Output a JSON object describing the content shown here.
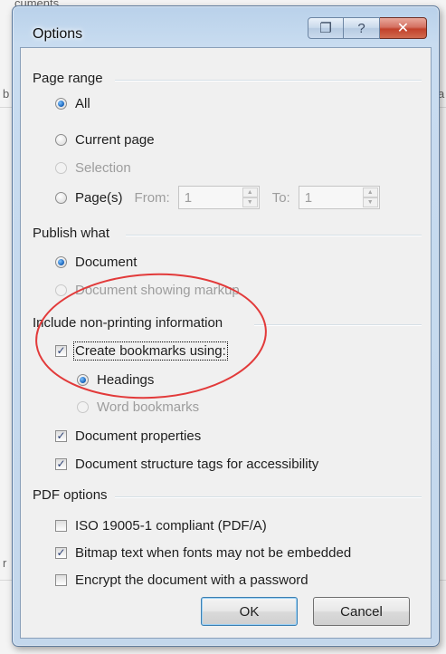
{
  "background": {
    "peek_text": "cuments",
    "peek_left": "b",
    "peek_right": "a",
    "peek_left2": "r"
  },
  "dialog": {
    "title": "Options",
    "titlebar_buttons": [
      {
        "name": "restore-icon",
        "glyph": "❐"
      },
      {
        "name": "help-icon",
        "glyph": "?"
      },
      {
        "name": "close-icon",
        "glyph": "✕"
      }
    ]
  },
  "page_range": {
    "label": "Page range",
    "options": [
      {
        "label": "All",
        "checked": true,
        "disabled": false
      },
      {
        "label": "Current page",
        "checked": false,
        "disabled": false
      },
      {
        "label": "Selection",
        "checked": false,
        "disabled": true
      },
      {
        "label": "Page(s)",
        "checked": false,
        "disabled": false
      }
    ],
    "from_label": "From:",
    "from_value": "1",
    "to_label": "To:",
    "to_value": "1"
  },
  "publish_what": {
    "label": "Publish what",
    "options": [
      {
        "label": "Document",
        "checked": true,
        "disabled": false
      },
      {
        "label": "Document showing markup",
        "checked": false,
        "disabled": true
      }
    ]
  },
  "non_printing": {
    "label": "Include non-printing information",
    "create_bookmarks": {
      "label": "Create bookmarks using:",
      "checked": true
    },
    "bookmark_options": [
      {
        "label": "Headings",
        "checked": true,
        "disabled": false
      },
      {
        "label": "Word bookmarks",
        "checked": false,
        "disabled": true
      }
    ],
    "document_properties": {
      "label": "Document properties",
      "checked": true
    },
    "structure_tags": {
      "label": "Document structure tags for accessibility",
      "checked": true
    }
  },
  "pdf_options": {
    "label": "PDF options",
    "iso": {
      "label": "ISO 19005-1 compliant (PDF/A)",
      "checked": false
    },
    "bitmap": {
      "label": "Bitmap text when fonts may not be embedded",
      "checked": true
    },
    "encrypt": {
      "label": "Encrypt the document with a password",
      "checked": false
    }
  },
  "buttons": {
    "ok": "OK",
    "cancel": "Cancel"
  },
  "colors": {
    "annotation_circle": "#e23a3a",
    "window_frame": "#c3d7ec",
    "client_bg": "#f0f0f0"
  }
}
